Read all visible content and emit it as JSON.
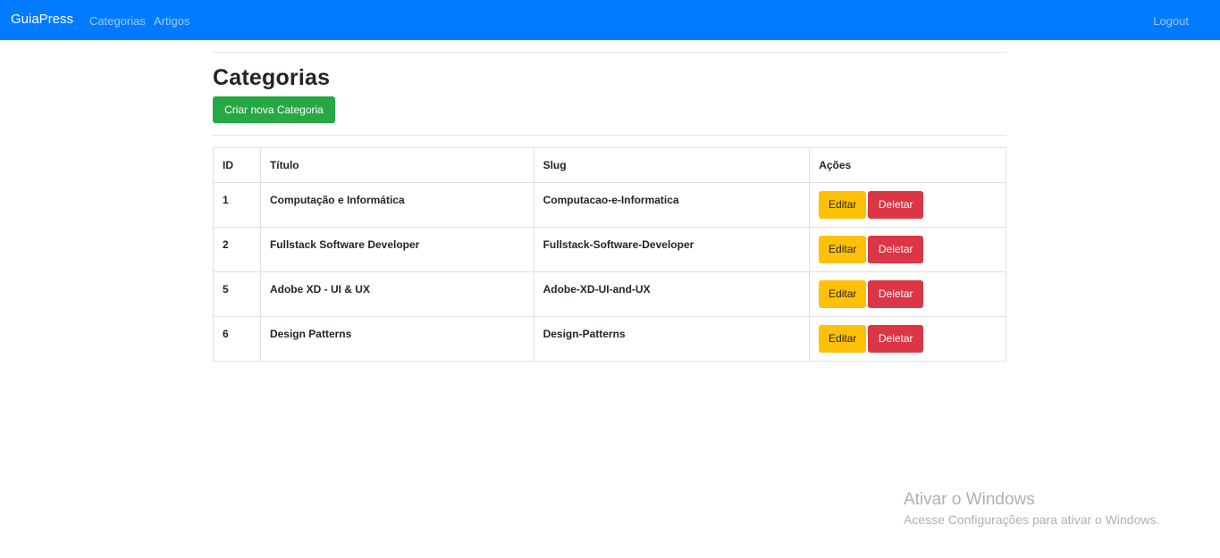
{
  "navbar": {
    "brand": "GuiaPress",
    "links": [
      "Categorias",
      "Artigos"
    ],
    "logout": "Logout"
  },
  "page": {
    "title": "Categorias",
    "new_button": "Criar nova Categoria"
  },
  "table": {
    "headers": [
      "ID",
      "Título",
      "Slug",
      "Ações"
    ],
    "rows": [
      {
        "id": "1",
        "title": "Computação e Informática",
        "slug": "Computacao-e-Informatica"
      },
      {
        "id": "2",
        "title": "Fullstack Software Developer",
        "slug": "Fullstack-Software-Developer"
      },
      {
        "id": "5",
        "title": "Adobe XD - UI & UX",
        "slug": "Adobe-XD-UI-and-UX"
      },
      {
        "id": "6",
        "title": "Design Patterns",
        "slug": "Design-Patterns"
      }
    ],
    "edit_label": "Editar",
    "delete_label": "Deletar"
  },
  "watermark": {
    "line1": "Ativar o Windows",
    "line2": "Acesse Configurações para ativar o Windows."
  },
  "colors": {
    "navbar": "#007bff",
    "success": "#28a745",
    "warning": "#ffc107",
    "danger": "#dc3545"
  }
}
